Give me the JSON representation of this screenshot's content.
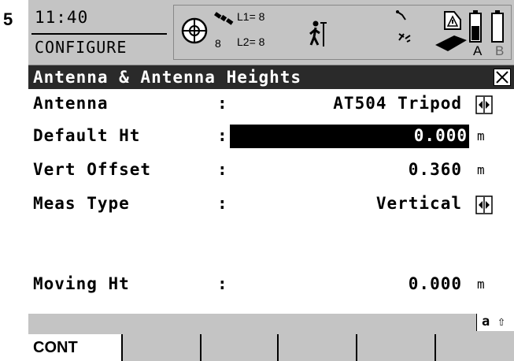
{
  "step": "5",
  "status": {
    "time": "11:40",
    "mode": "CONFIGURE",
    "satellites": {
      "count": "8",
      "l1": "L1= 8",
      "l2": "L2= 8"
    },
    "battery_a": "A",
    "battery_b": "B",
    "icons": [
      "position-icon",
      "satellite-icon",
      "walking-person-icon",
      "link-icon",
      "memory-card-icon",
      "battery-icon"
    ]
  },
  "title_bar": {
    "title": "Antenna & Antenna Heights",
    "close": "X"
  },
  "fields": {
    "antenna": {
      "label": "Antenna",
      "colon": ":",
      "value": "AT504 Tripod"
    },
    "default_ht": {
      "label": "Default Ht",
      "colon": ":",
      "value": "0.000",
      "unit": "m"
    },
    "vert_offset": {
      "label": "Vert Offset",
      "colon": ":",
      "value": "0.360",
      "unit": "m"
    },
    "meas_type": {
      "label": "Meas Type",
      "colon": ":",
      "value": "Vertical"
    },
    "moving_ht": {
      "label": "Moving Ht",
      "colon": ":",
      "value": "0.000",
      "unit": "m"
    }
  },
  "input_mode": {
    "alpha": "a",
    "shift": "⇧"
  },
  "softkeys": [
    "CONT",
    "",
    "",
    "",
    "",
    ""
  ]
}
